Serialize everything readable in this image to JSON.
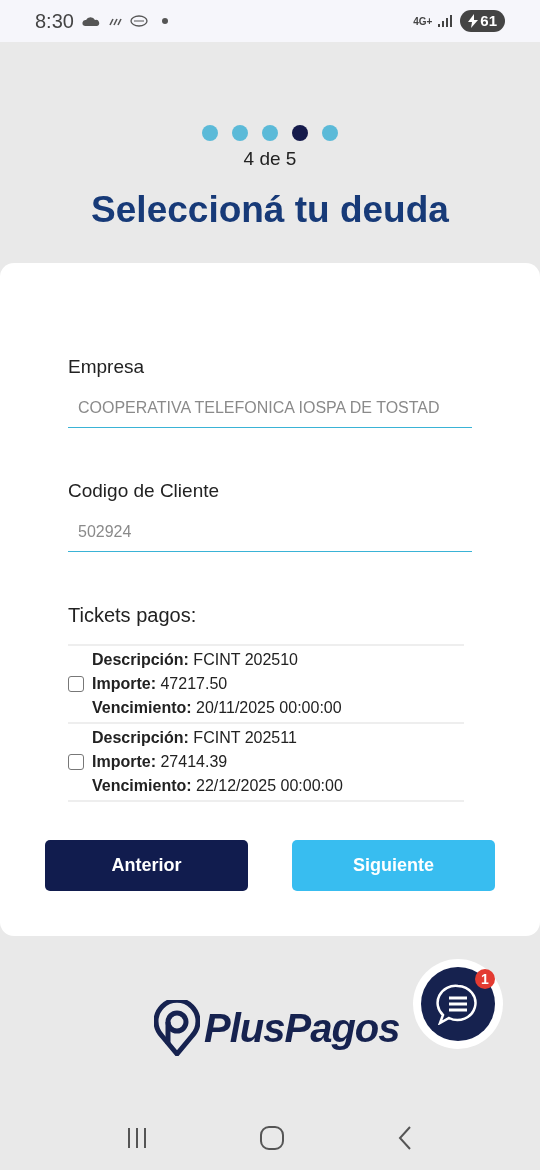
{
  "status_bar": {
    "time": "8:30",
    "network": "4G+",
    "battery": "61"
  },
  "steps": [
    {
      "selected": false
    },
    {
      "selected": false
    },
    {
      "selected": false
    },
    {
      "selected": true
    },
    {
      "selected": false
    }
  ],
  "step_label": "4 de 5",
  "title": "Seleccioná tu deuda",
  "fields": [
    {
      "label": "Empresa",
      "value": "COOPERATIVA TELEFONICA IOSPA DE TOSTAD"
    },
    {
      "label": "Codigo de Cliente",
      "value": "502924"
    }
  ],
  "tickets": {
    "title": "Tickets pagos:",
    "items": [
      {
        "checked": false,
        "lines": [
          {
            "label": "Descripción:",
            "value": "FCINT 202510"
          },
          {
            "label": "Importe:",
            "value": "47217.50"
          },
          {
            "label": "Vencimiento:",
            "value": "20/11/2025 00:00:00"
          }
        ]
      },
      {
        "checked": false,
        "lines": [
          {
            "label": "Descripción:",
            "value": "FCINT 202511"
          },
          {
            "label": "Importe:",
            "value": "27414.39"
          },
          {
            "label": "Vencimiento:",
            "value": "22/12/2025 00:00:00"
          }
        ]
      }
    ]
  },
  "buttons": [
    {
      "kind": "secondary",
      "label": "Anterior"
    },
    {
      "kind": "primary",
      "label": "Siguiente"
    }
  ],
  "logo": "PlusPagos",
  "chat": {
    "badge": "1"
  }
}
